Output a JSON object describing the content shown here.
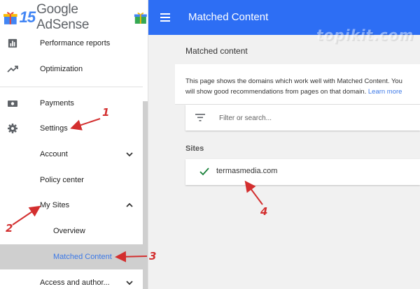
{
  "brand": {
    "logo_number": "15",
    "logo_text": "Google AdSense"
  },
  "sidebar": {
    "items": [
      {
        "label": "Performance reports",
        "icon": "bar-chart-icon"
      },
      {
        "label": "Optimization",
        "icon": "trending-up-icon"
      },
      {
        "label": "Payments",
        "icon": "payments-icon"
      },
      {
        "label": "Settings",
        "icon": "gear-icon"
      },
      {
        "label": "Account",
        "icon": "chevron-down-icon"
      },
      {
        "label": "Policy center"
      },
      {
        "label": "My Sites",
        "icon": "chevron-up-icon"
      },
      {
        "label": "Overview"
      },
      {
        "label": "Matched Content",
        "active": true
      },
      {
        "label": "Access and author...",
        "icon": "chevron-down-icon"
      }
    ]
  },
  "topbar": {
    "title": "Matched Content",
    "color": "#2d6ef4"
  },
  "main": {
    "title": "Matched content",
    "description_line1": "This page shows the domains which work well with Matched Content. You",
    "description_line2": "will show good recommendations from pages on that domain.",
    "learn_more": "Learn more",
    "search_placeholder": "Filter or search...",
    "sites_label": "Sites",
    "sites": [
      {
        "domain": "termasmedia.com",
        "status": "check-icon"
      }
    ]
  },
  "watermark": "topikit.com",
  "annotations": [
    "1",
    "2",
    "3",
    "4"
  ],
  "colors": {
    "accent": "#3b78e7",
    "annotation": "#d32f2f",
    "check": "#188038"
  }
}
